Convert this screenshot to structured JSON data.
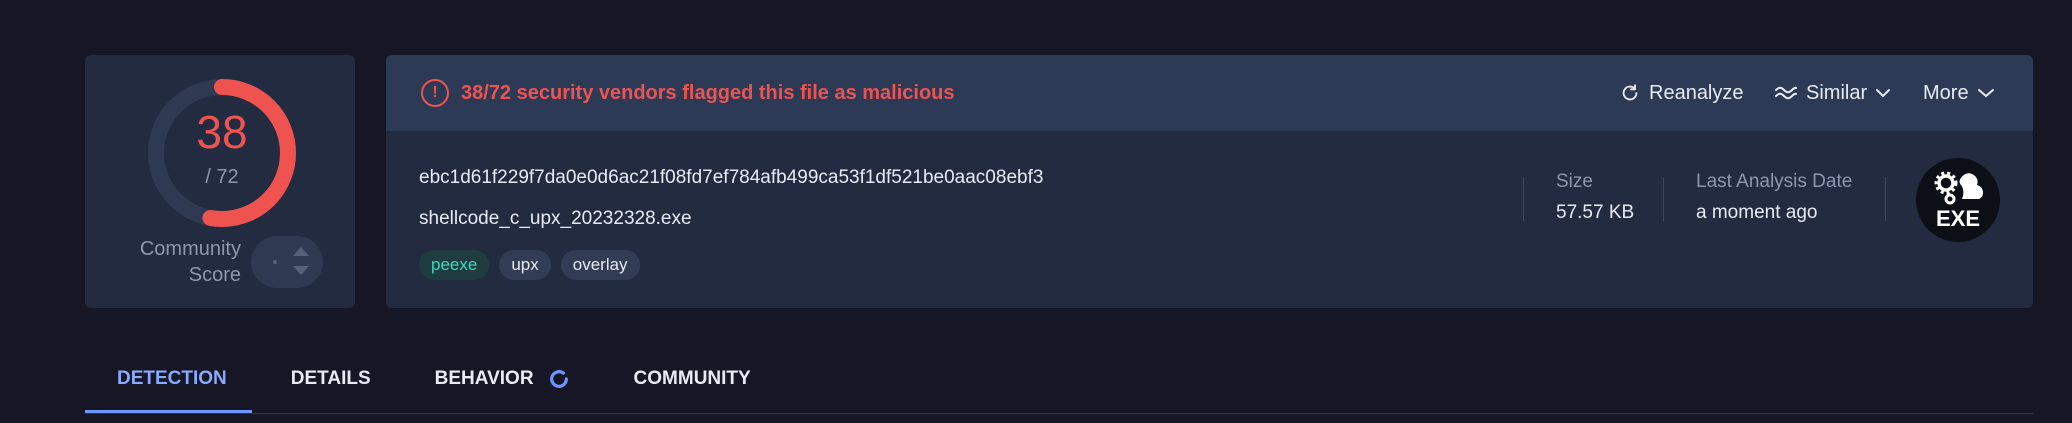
{
  "colors": {
    "background": "#161624",
    "card": "#232b40",
    "alert_bar": "#2c3a55",
    "danger": "#ef5350",
    "accent": "#8aa9ff",
    "tag_peexe": "#3fd6c0",
    "muted": "#8c96ad"
  },
  "score": {
    "detected": "38",
    "total": "/ 72",
    "detected_fraction": 0.5278,
    "community_label": "Community Score"
  },
  "alert": {
    "icon": "exclamation-circle-icon",
    "text": "38/72 security vendors flagged this file as malicious"
  },
  "actions": {
    "reanalyze": {
      "label": "Reanalyze",
      "icon": "refresh-icon"
    },
    "similar": {
      "label": "Similar",
      "icon": "waves-icon"
    },
    "more": {
      "label": "More"
    }
  },
  "file": {
    "hash": "ebc1d61f229f7da0e0d6ac21f08fd7ef784afb499ca53f1df521be0aac08ebf3",
    "name": "shellcode_c_upx_20232328.exe",
    "tags": [
      "peexe",
      "upx",
      "overlay"
    ],
    "size_label": "Size",
    "size_value": "57.57 KB",
    "last_analysis_label": "Last Analysis Date",
    "last_analysis_value": "a moment ago",
    "type_badge": "EXE"
  },
  "tabs": [
    {
      "label": "DETECTION",
      "active": true
    },
    {
      "label": "DETAILS",
      "active": false
    },
    {
      "label": "BEHAVIOR",
      "active": false,
      "loading": true
    },
    {
      "label": "COMMUNITY",
      "active": false
    }
  ]
}
